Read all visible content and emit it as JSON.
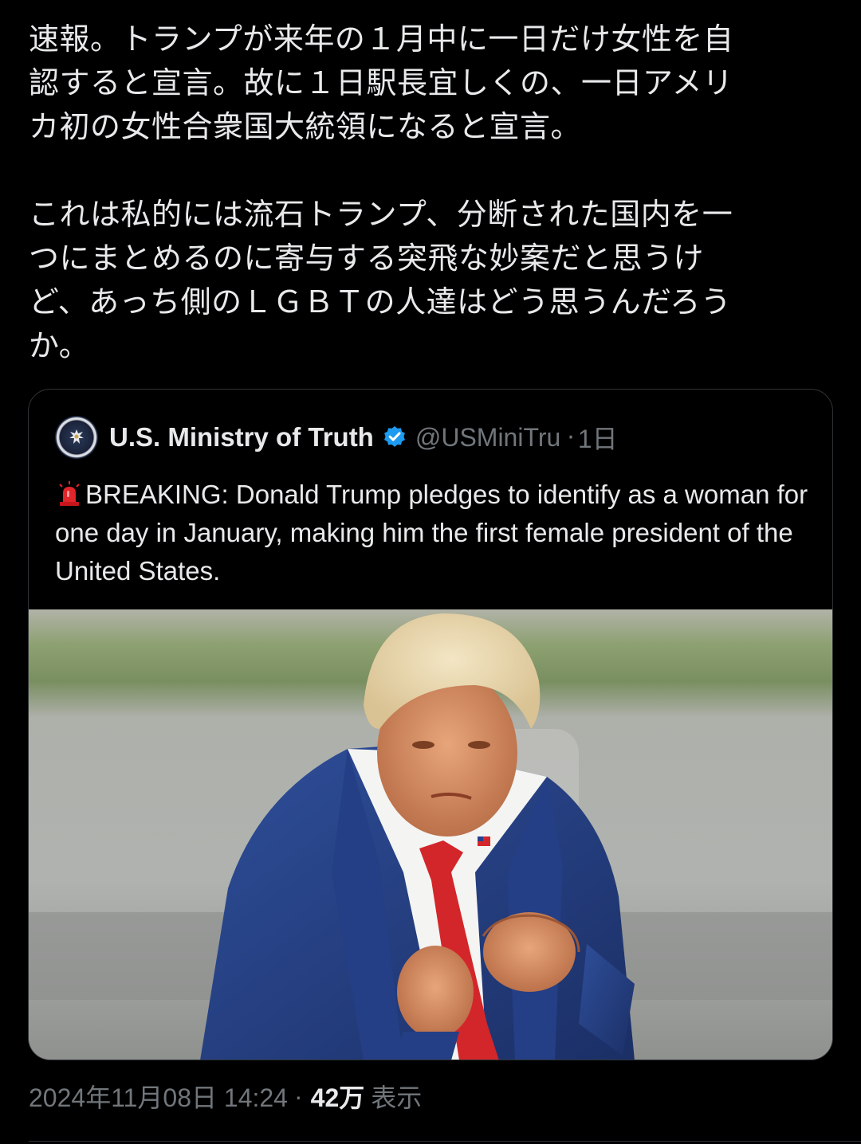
{
  "tweet": {
    "text_lines_p1": [
      "速報。トランプが来年の１月中に一日だけ女性を自",
      "認すると宣言。故に１日駅長宜しくの、一日アメリ",
      "カ初の女性合衆国大統領になると宣言。"
    ],
    "text_lines_p2": [
      "これは私的には流石トランプ、分断された国内を一",
      "つにまとめるのに寄与する突飛な妙案だと思うけ",
      "ど、あっち側のＬＧＢＴの人達はどう思うんだろう",
      "か。"
    ]
  },
  "quote": {
    "author_name": "U.S. Ministry of Truth",
    "handle": "@USMiniTru",
    "separator": "·",
    "time": "1日",
    "body_text": "BREAKING: Donald Trump pledges to identify as a woman for one day in January, making him the first female president of the United States.",
    "avatar_icon": "ministry-seal-icon",
    "verified_icon": "verified-badge-icon",
    "emoji_icon": "siren-icon"
  },
  "meta": {
    "timestamp": "2024年11月08日 14:24",
    "separator": "·",
    "views_count": "42万",
    "views_label": "表示"
  },
  "colors": {
    "background": "#000000",
    "text_primary": "#e7e9ea",
    "text_secondary": "#71767b",
    "border": "#2f3336",
    "verified_blue": "#1d9bf0",
    "siren_red": "#e0252b"
  }
}
